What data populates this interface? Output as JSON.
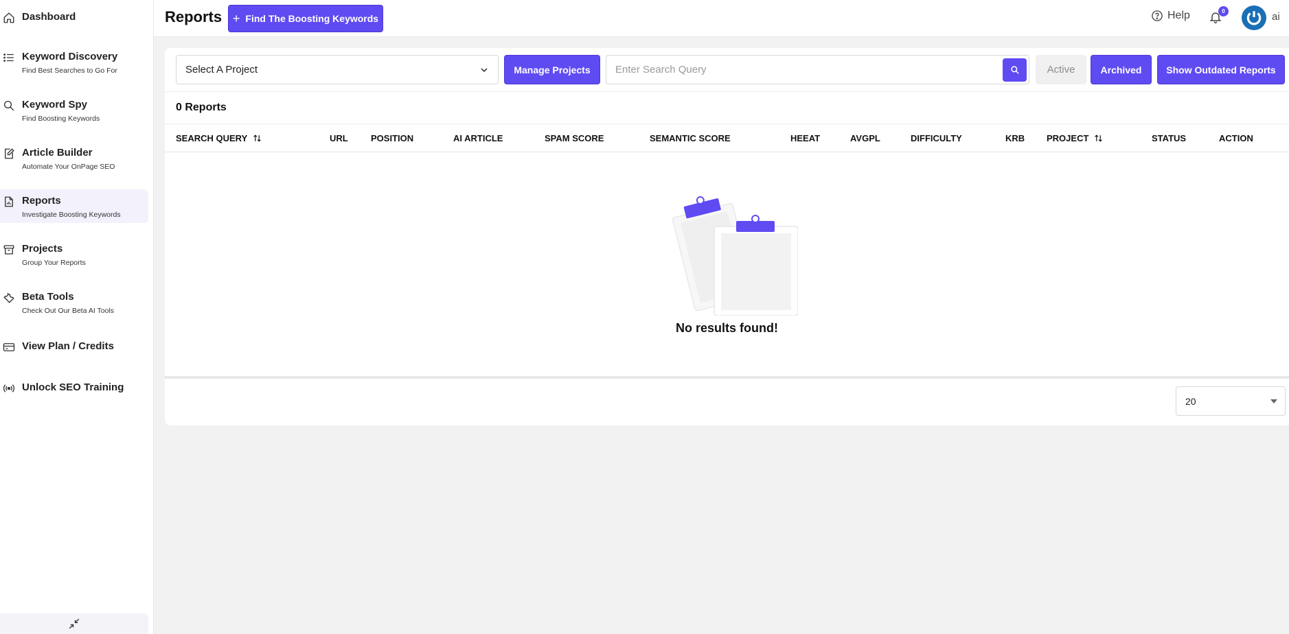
{
  "sidebar": {
    "items": [
      {
        "title": "Dashboard",
        "sub": "",
        "icon": "home-icon"
      },
      {
        "title": "Keyword Discovery",
        "sub": "Find Best Searches to Go For",
        "icon": "list-icon"
      },
      {
        "title": "Keyword Spy",
        "sub": "Find Boosting Keywords",
        "icon": "search-icon"
      },
      {
        "title": "Article Builder",
        "sub": "Automate Your OnPage SEO",
        "icon": "edit-document-icon"
      },
      {
        "title": "Reports",
        "sub": "Investigate Boosting Keywords",
        "icon": "report-icon"
      },
      {
        "title": "Projects",
        "sub": "Group Your Reports",
        "icon": "archive-box-icon"
      },
      {
        "title": "Beta Tools",
        "sub": "Check Out Our Beta AI Tools",
        "icon": "wrench-icon"
      },
      {
        "title": "View Plan / Credits",
        "sub": "",
        "icon": "credit-card-icon"
      },
      {
        "title": "Unlock SEO Training",
        "sub": "",
        "icon": "broadcast-icon"
      }
    ],
    "active_index": 4
  },
  "header": {
    "title": "Reports",
    "find_button": "Find The Boosting Keywords",
    "help": "Help",
    "notification_count": "0",
    "user_label": "ai"
  },
  "filters": {
    "project_select": "Select A Project",
    "manage_projects": "Manage Projects",
    "search_placeholder": "Enter Search Query",
    "active": "Active",
    "archived": "Archived",
    "outdated": "Show Outdated Reports"
  },
  "table": {
    "count_label": "0 Reports",
    "columns": [
      "SEARCH QUERY",
      "URL",
      "POSITION",
      "AI ARTICLE",
      "SPAM SCORE",
      "SEMANTIC SCORE",
      "HEEAT",
      "AVGPL",
      "DIFFICULTY",
      "KRB",
      "PROJECT",
      "STATUS",
      "ACTION"
    ],
    "empty_message": "No results found!",
    "per_page": "20"
  },
  "colors": {
    "accent": "#5f4bf2",
    "avatar": "#1a6fb5"
  }
}
